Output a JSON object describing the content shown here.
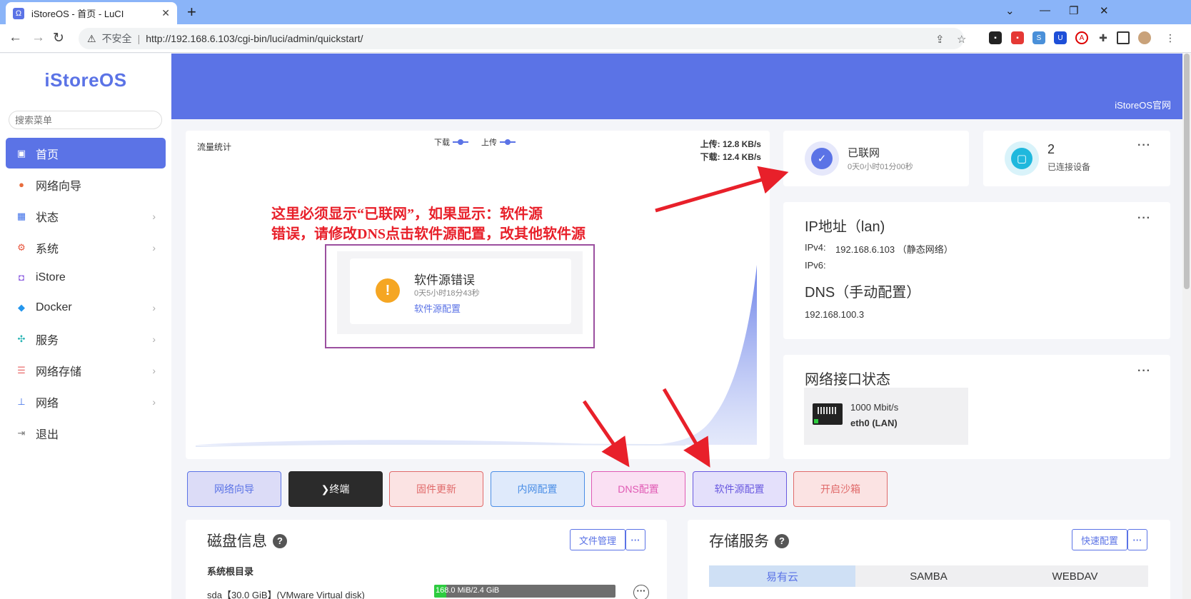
{
  "browser": {
    "tab_title": "iStoreOS - 首页 - LuCI",
    "tab_close": "✕",
    "new_tab": "+",
    "security_label": "不安全",
    "url": "http://192.168.6.103/cgi-bin/luci/admin/quickstart/"
  },
  "sidebar": {
    "logo": "iStoreOS",
    "search_placeholder": "搜索菜单",
    "items": [
      {
        "label": "首页"
      },
      {
        "label": "网络向导"
      },
      {
        "label": "状态"
      },
      {
        "label": "系统"
      },
      {
        "label": "iStore"
      },
      {
        "label": "Docker"
      },
      {
        "label": "服务"
      },
      {
        "label": "网络存储"
      },
      {
        "label": "网络"
      },
      {
        "label": "退出"
      }
    ]
  },
  "header": {
    "site_link": "iStoreOS官网"
  },
  "traffic": {
    "title": "流量统计",
    "legend_download": "下载",
    "legend_upload": "上传",
    "upload_speed": "上传: 12.8 KB/s",
    "download_speed": "下载: 12.4 KB/s"
  },
  "annotation": {
    "line1": "这里必须显示“已联网”，如果显示：软件源",
    "line2": "错误，请修改DNS点击软件源配置，改其他软件源"
  },
  "source_status": {
    "title": "软件源错误",
    "time": "0天5小时18分43秒",
    "link": "软件源配置"
  },
  "network_status": {
    "title": "已联网",
    "time": "0天0小时01分00秒"
  },
  "devices": {
    "count": "2",
    "label": "已连接设备"
  },
  "ip_card": {
    "title": "IP地址（lan)",
    "ipv4_label": "IPv4:",
    "ipv4_value": "192.168.6.103 （静态网络）",
    "ipv6_label": "IPv6:",
    "dns_title": "DNS（手动配置）",
    "dns_value": "192.168.100.3"
  },
  "iface_card": {
    "title": "网络接口状态",
    "speed": "1000 Mbit/s",
    "name": "eth0 (LAN)"
  },
  "quick_buttons": [
    {
      "label": "网络向导",
      "color": "#5b73e6",
      "bg": "#dcdcf7"
    },
    {
      "label": "❯终端",
      "color": "#ffffff",
      "bg": "#2b2b2b"
    },
    {
      "label": "固件更新",
      "color": "#e06a6a",
      "bg": "#fbe3e3"
    },
    {
      "label": "内网配置",
      "color": "#4a8ee6",
      "bg": "#dfeafb"
    },
    {
      "label": "DNS配置",
      "color": "#e05ab4",
      "bg": "#fae0f3"
    },
    {
      "label": "软件源配置",
      "color": "#6a5ae0",
      "bg": "#e4e0fb"
    },
    {
      "label": "开启沙箱",
      "color": "#e06a6a",
      "bg": "#fbe3e3"
    }
  ],
  "disk": {
    "title": "磁盘信息",
    "file_btn": "文件管理",
    "section": "系统根目录",
    "row_label": "sda【30.0 GiB】(VMware Virtual disk)",
    "bar_text": "168.0 MiB/2.4 GiB",
    "used_fraction": 0.068
  },
  "storage": {
    "title": "存储服务",
    "config_btn": "快速配置",
    "tabs": [
      "易有云",
      "SAMBA",
      "WEBDAV"
    ]
  }
}
